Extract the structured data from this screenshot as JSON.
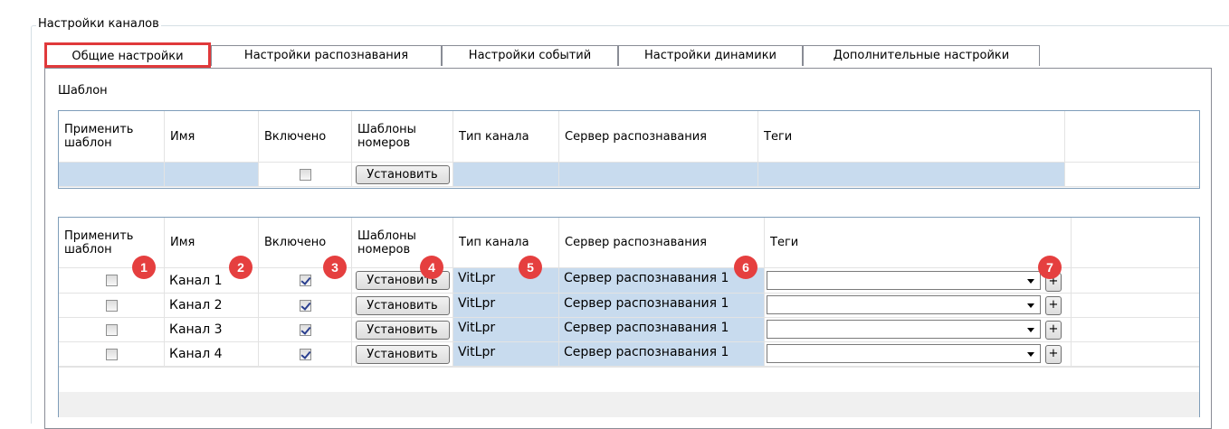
{
  "group": {
    "title": "Настройки каналов"
  },
  "tabs": [
    {
      "label": "Общие настройки",
      "active": true
    },
    {
      "label": "Настройки распознавания",
      "active": false
    },
    {
      "label": "Настройки событий",
      "active": false
    },
    {
      "label": "Настройки динамики",
      "active": false
    },
    {
      "label": "Дополнительные настройки",
      "active": false
    }
  ],
  "template": {
    "label": "Шаблон",
    "headers": [
      "Применить шаблон",
      "Имя",
      "Включено",
      "Шаблоны номеров",
      "Тип канала",
      "Сервер распознавания",
      "Теги"
    ],
    "row": {
      "enabled": false,
      "button_label": "Установить"
    }
  },
  "channels": {
    "headers": [
      "Применить шаблон",
      "Имя",
      "Включено",
      "Шаблоны номеров",
      "Тип канала",
      "Сервер распознавания",
      "Теги"
    ],
    "rows": [
      {
        "apply": false,
        "name": "Канал 1",
        "enabled": true,
        "button_label": "Установить",
        "type": "VitLpr",
        "server": "Сервер распознавания 1",
        "tags": "",
        "add_label": "+"
      },
      {
        "apply": false,
        "name": "Канал 2",
        "enabled": true,
        "button_label": "Установить",
        "type": "VitLpr",
        "server": "Сервер распознавания 1",
        "tags": "",
        "add_label": "+"
      },
      {
        "apply": false,
        "name": "Канал 3",
        "enabled": true,
        "button_label": "Установить",
        "type": "VitLpr",
        "server": "Сервер распознавания 1",
        "tags": "",
        "add_label": "+"
      },
      {
        "apply": false,
        "name": "Канал 4",
        "enabled": true,
        "button_label": "Установить",
        "type": "VitLpr",
        "server": "Сервер распознавания 1",
        "tags": "",
        "add_label": "+"
      }
    ]
  },
  "callouts": [
    "1",
    "2",
    "3",
    "4",
    "5",
    "6",
    "7"
  ],
  "colors": {
    "accent_red": "#e0393b",
    "badge_red": "#e53f3f",
    "cell_shade": "#c8dbee",
    "grid_border": "#7f9db9"
  }
}
